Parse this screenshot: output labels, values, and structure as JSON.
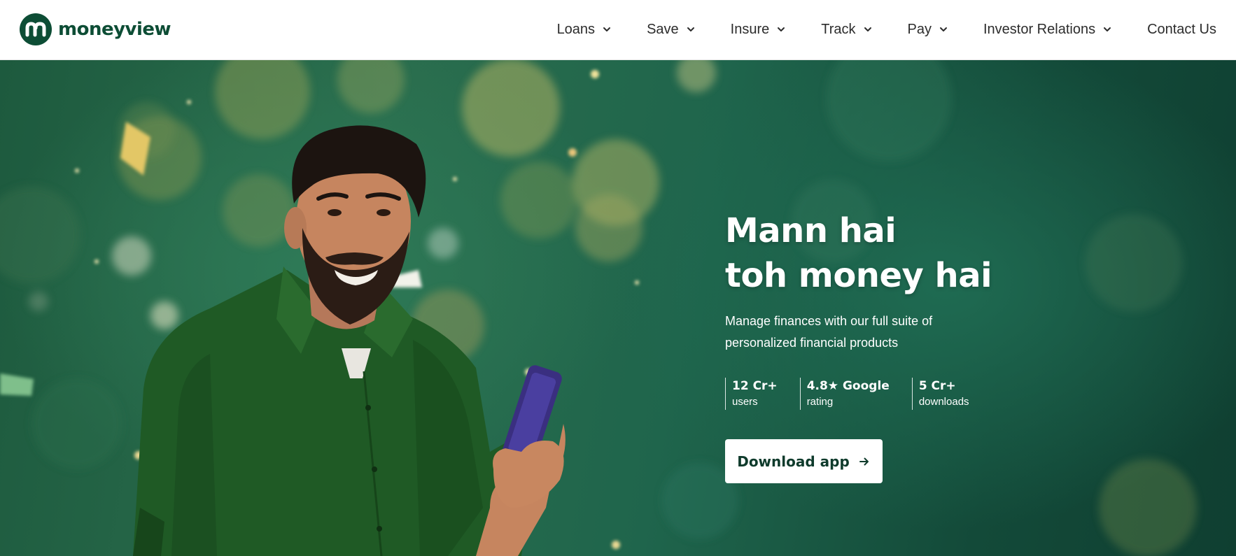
{
  "brand": {
    "name": "moneyview",
    "logo_icon": "moneyview-m-logo-icon",
    "color": "#0d4d35"
  },
  "nav": {
    "items": [
      {
        "label": "Loans",
        "has_dropdown": true
      },
      {
        "label": "Save",
        "has_dropdown": true
      },
      {
        "label": "Insure",
        "has_dropdown": true
      },
      {
        "label": "Track",
        "has_dropdown": true
      },
      {
        "label": "Pay",
        "has_dropdown": true
      },
      {
        "label": "Investor Relations",
        "has_dropdown": true
      },
      {
        "label": "Contact Us",
        "has_dropdown": false
      }
    ],
    "dropdown_icon": "chevron-down-icon"
  },
  "hero": {
    "headline_line1": "Mann hai",
    "headline_line2": "toh money hai",
    "subtext": "Manage finances with our full suite of personalized financial products",
    "stats": [
      {
        "value": "12 Cr+",
        "label": "users"
      },
      {
        "value": "4.8★ Google",
        "label": "rating"
      },
      {
        "value": "5 Cr+",
        "label": "downloads"
      }
    ],
    "cta_label": "Download app",
    "cta_icon": "arrow-right-icon",
    "background_color": "#1f5f45",
    "image_subject": "smiling man in green shirt holding smartphone"
  }
}
